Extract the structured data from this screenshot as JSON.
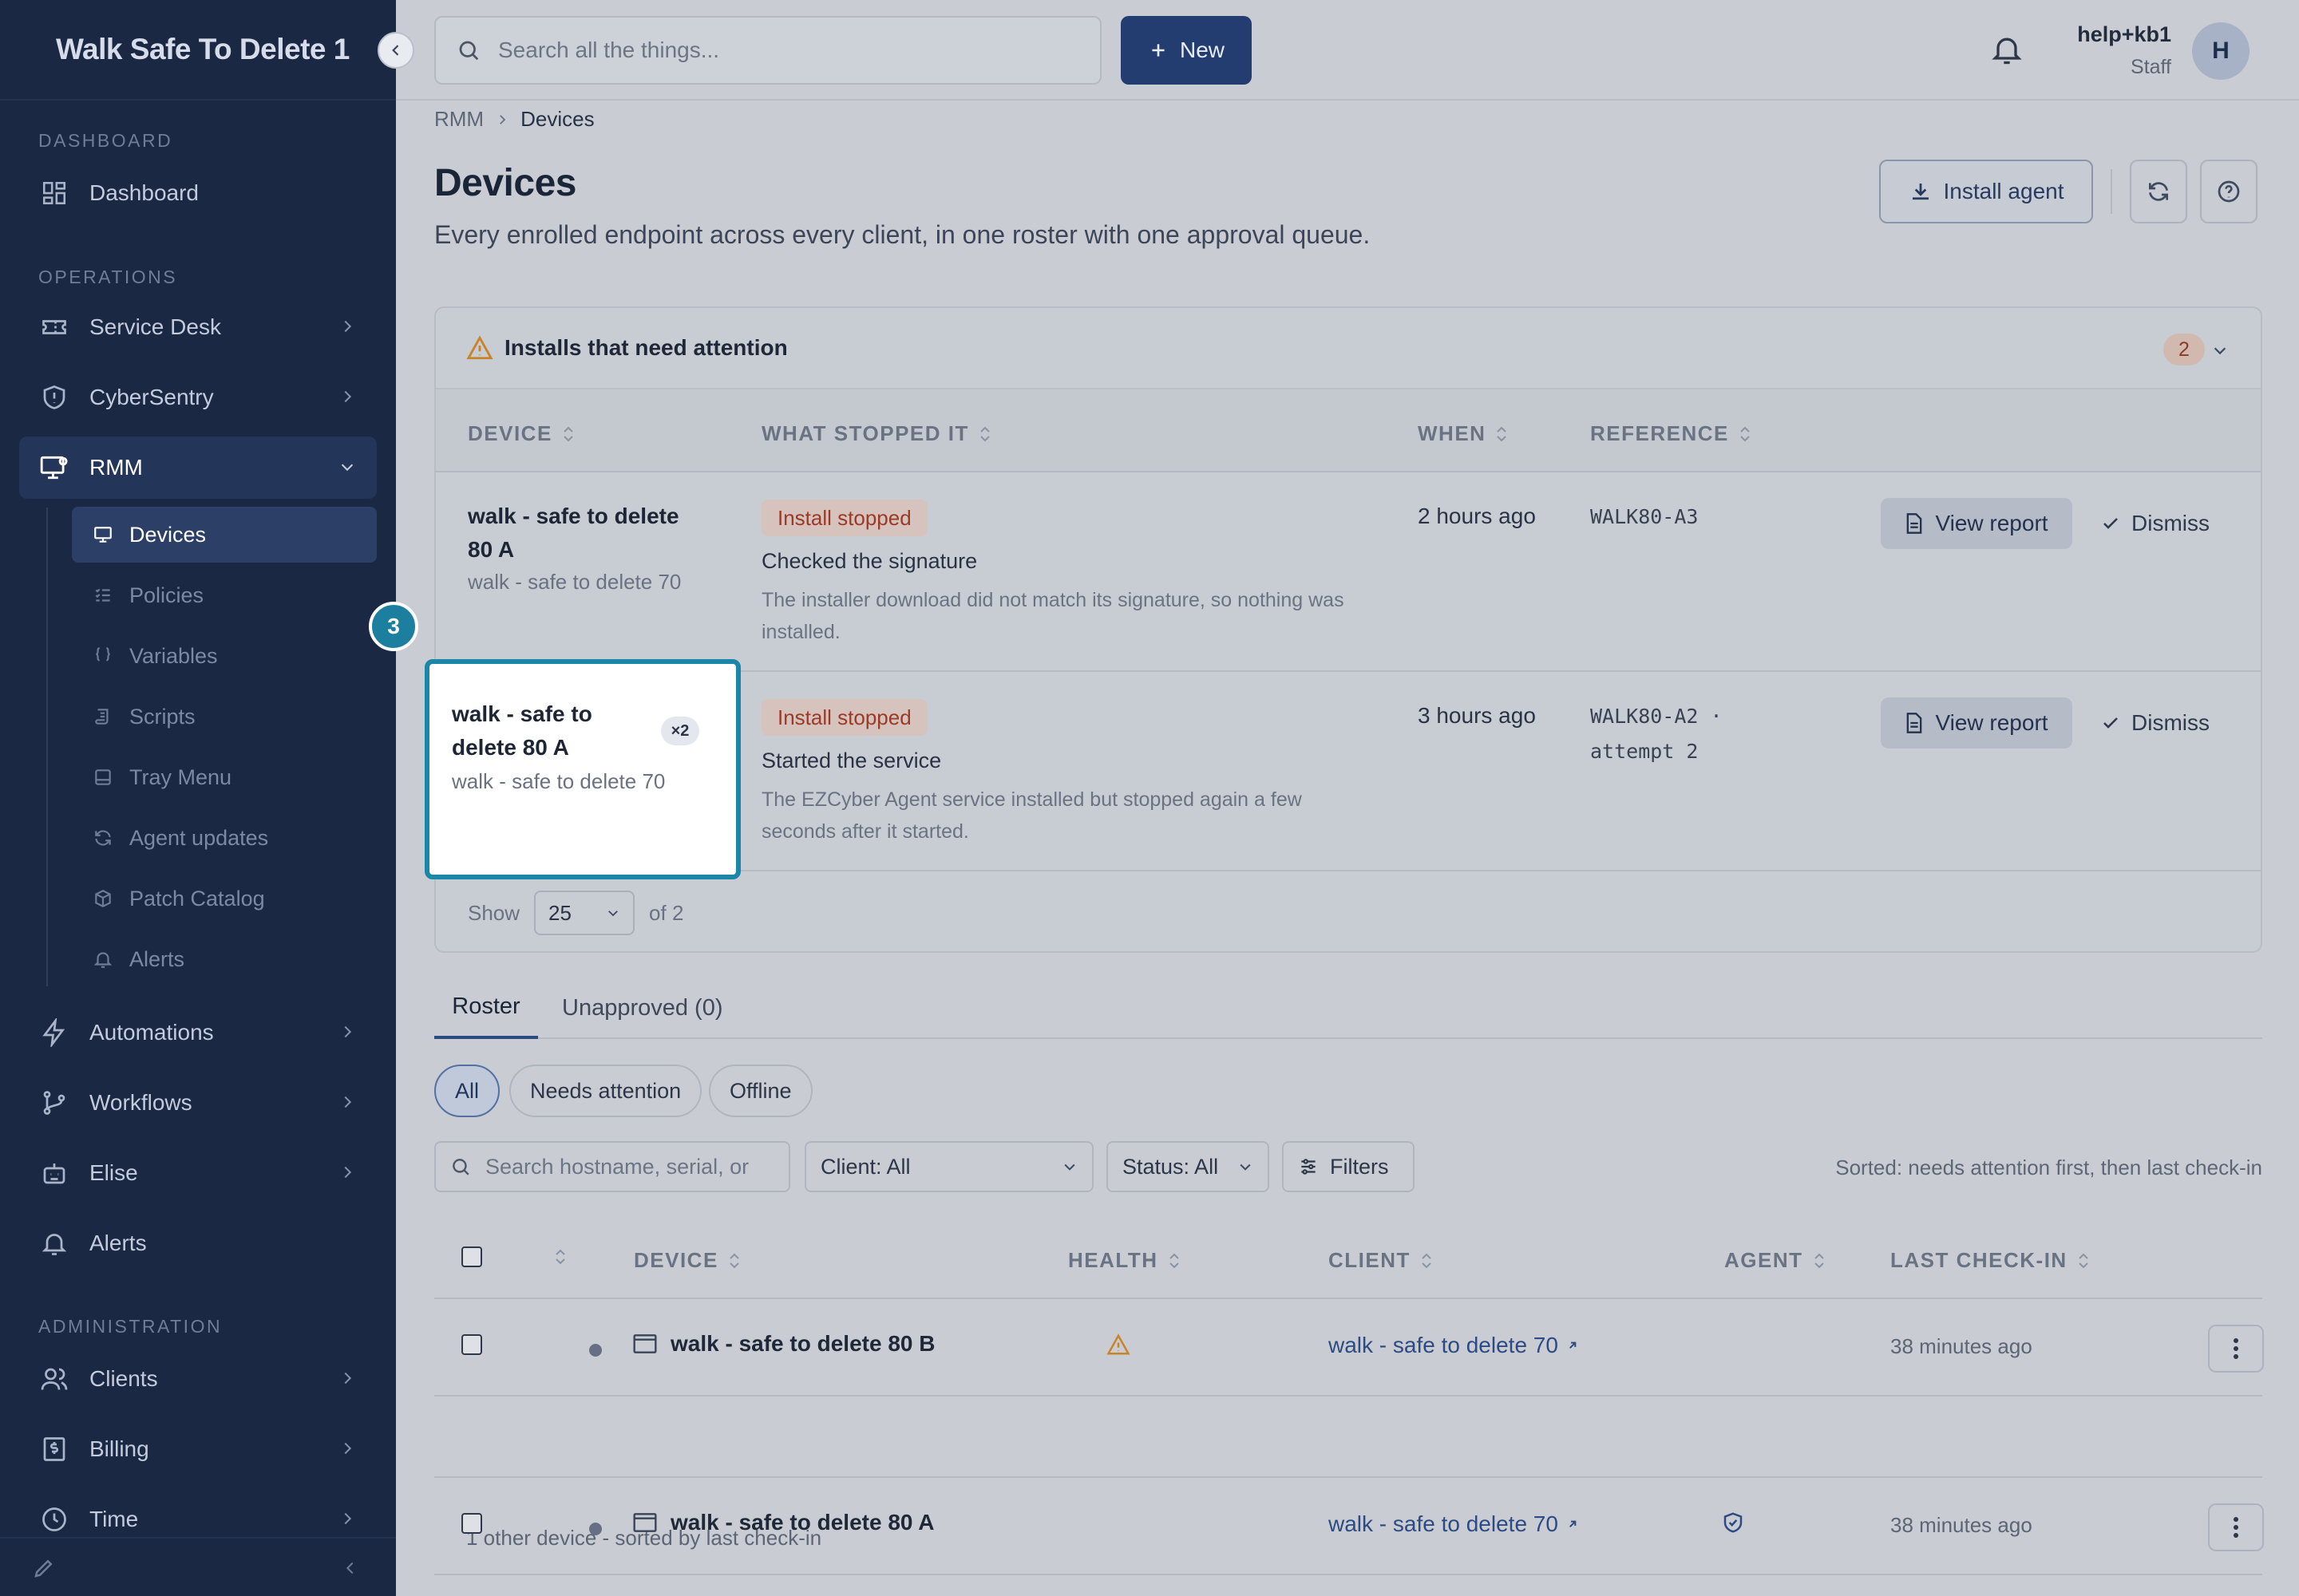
{
  "sidebar": {
    "brand": "Walk Safe To Delete 1",
    "sections": {
      "dashboard": "DASHBOARD",
      "operations": "OPERATIONS",
      "administration": "ADMINISTRATION"
    },
    "items": {
      "dashboard": "Dashboard",
      "service_desk": "Service Desk",
      "cybersentry": "CyberSentry",
      "rmm": "RMM",
      "automations": "Automations",
      "workflows": "Workflows",
      "elise": "Elise",
      "alerts": "Alerts",
      "clients": "Clients",
      "billing": "Billing",
      "time": "Time"
    },
    "rmm_sub": {
      "devices": "Devices",
      "policies": "Policies",
      "variables": "Variables",
      "scripts": "Scripts",
      "tray_menu": "Tray Menu",
      "agent_updates": "Agent updates",
      "patch_catalog": "Patch Catalog",
      "alerts": "Alerts"
    }
  },
  "step_badge": "3",
  "topbar": {
    "search_placeholder": "Search all the things...",
    "new_label": "New",
    "user_name": "help+kb1",
    "user_role": "Staff",
    "avatar_initial": "H"
  },
  "breadcrumb": {
    "parent": "RMM",
    "current": "Devices"
  },
  "page": {
    "title": "Devices",
    "subtitle": "Every enrolled endpoint across every client, in one roster with one approval queue.",
    "install_agent": "Install agent"
  },
  "attention": {
    "title": "Installs that need attention",
    "count": "2",
    "columns": {
      "device": "DEVICE",
      "what": "WHAT STOPPED IT",
      "when": "WHEN",
      "reference": "REFERENCE"
    },
    "rows": [
      {
        "device": "walk - safe to delete 80 A",
        "client": "walk - safe to delete 70",
        "status": "Install stopped",
        "step": "Checked the signature",
        "detail": "The installer download did not match its signature, so nothing was installed.",
        "when": "2 hours ago",
        "reference": "WALK80-A3",
        "view": "View report",
        "dismiss": "Dismiss"
      },
      {
        "device": "walk - safe to delete 80 A",
        "client": "walk - safe to delete 70",
        "multiplier": "×2",
        "status": "Install stopped",
        "step": "Started the service",
        "detail": "The EZCyber Agent service installed but stopped again a few seconds after it started.",
        "when": "3 hours ago",
        "reference": "WALK80-A2 · attempt 2",
        "view": "View report",
        "dismiss": "Dismiss"
      }
    ],
    "footer": {
      "show": "Show",
      "page_size": "25",
      "of_total": "of 2"
    }
  },
  "tabs": {
    "roster": "Roster",
    "unapproved": "Unapproved (0)"
  },
  "chips": {
    "all": "All",
    "needs_attention": "Needs attention",
    "offline": "Offline"
  },
  "filters": {
    "search_placeholder": "Search hostname, serial, or",
    "client": "Client: All",
    "status": "Status: All",
    "filters": "Filters",
    "sorted_note": "Sorted: needs attention first, then last check-in"
  },
  "roster": {
    "columns": {
      "device": "DEVICE",
      "health": "HEALTH",
      "client": "CLIENT",
      "agent": "AGENT",
      "last_checkin": "LAST CHECK-IN"
    },
    "rows": [
      {
        "device": "walk - safe to delete 80 B",
        "client": "walk - safe to delete 70",
        "health": "warning-icon",
        "agent": "",
        "last_checkin": "38 minutes ago"
      },
      {
        "device": "walk - safe to delete 80 A",
        "client": "walk - safe to delete 70",
        "health": "",
        "agent": "shield-check-icon",
        "last_checkin": "38 minutes ago"
      }
    ],
    "group_note": "1 other device - sorted by last check-in"
  },
  "colors": {
    "sidebar_bg": "#1a2844",
    "accent": "#233d70",
    "highlight": "#1b87a8",
    "danger": "#9b3a26",
    "warning": "#c9832a"
  }
}
